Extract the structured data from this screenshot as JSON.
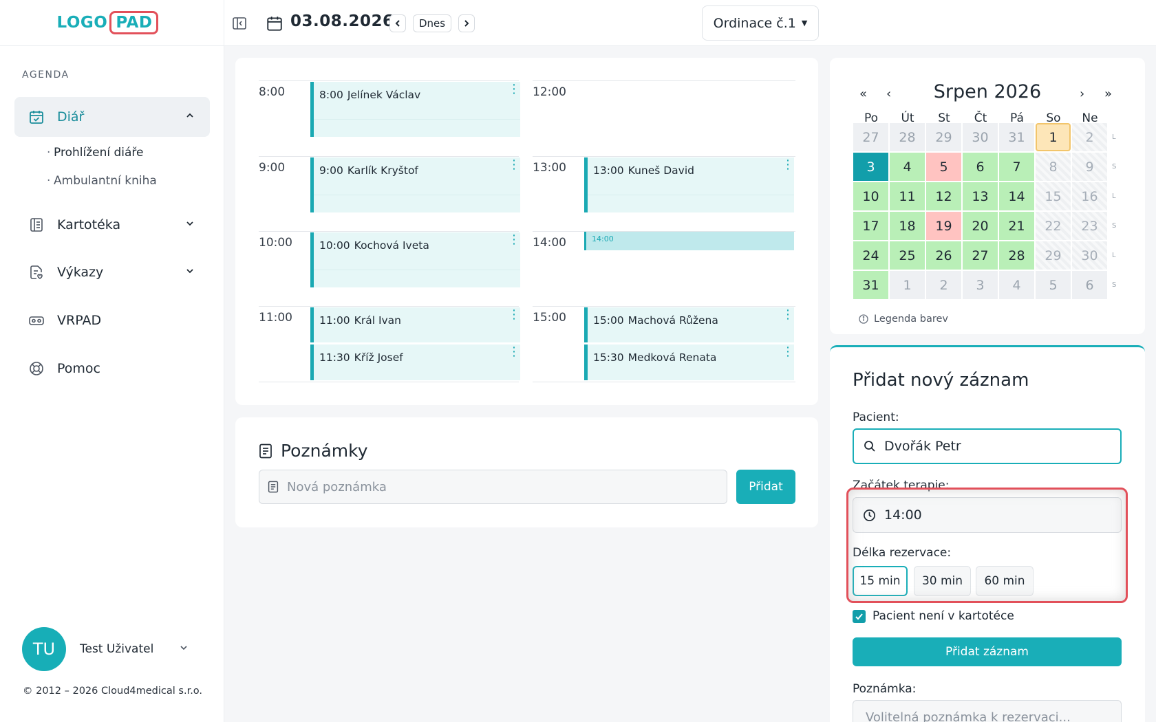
{
  "logo": {
    "part1": "LOGO",
    "part2": "PAD"
  },
  "sidebar": {
    "section_label": "AGENDA",
    "items": [
      {
        "label": "Diář",
        "icon": "calendar-check-icon"
      },
      {
        "label": "Kartotéka",
        "icon": "book-icon"
      },
      {
        "label": "Výkazy",
        "icon": "report-icon"
      },
      {
        "label": "VRPAD",
        "icon": "vr-headset-icon"
      },
      {
        "label": "Pomoc",
        "icon": "lifebuoy-icon"
      }
    ],
    "subitems": [
      "Prohlížení diáře",
      "Ambulantní kniha"
    ],
    "user": {
      "initials": "TU",
      "name": "Test Uživatel"
    },
    "copyright": "© 2012 – 2026 Cloud4medical s.r.o."
  },
  "topbar": {
    "date": "03.08.2026",
    "today_label": "Dnes",
    "office": "Ordinace č.1"
  },
  "schedule": {
    "hours": [
      "8:00",
      "9:00",
      "10:00",
      "11:00",
      "12:00",
      "13:00",
      "14:00",
      "15:00"
    ],
    "appointments": [
      {
        "time": "8:00",
        "name": "Jelínek Václav"
      },
      {
        "time": "9:00",
        "name": "Karlík Kryštof"
      },
      {
        "time": "10:00",
        "name": "Kochová Iveta"
      },
      {
        "time": "11:00",
        "name": "Král Ivan"
      },
      {
        "time": "11:30",
        "name": "Kříž Josef"
      },
      {
        "time": "13:00",
        "name": "Kuneš David"
      },
      {
        "time": "14:00",
        "name": ""
      },
      {
        "time": "15:00",
        "name": "Machová Růžena"
      },
      {
        "time": "15:30",
        "name": "Medková Renata"
      }
    ]
  },
  "notes": {
    "title": "Poznámky",
    "placeholder": "Nová poznámka",
    "add_label": "Přidat"
  },
  "calendar": {
    "prev_year": "«",
    "prev_month": "‹",
    "next_month": "›",
    "next_year": "»",
    "month": "Srpen 2026",
    "weekdays": [
      "Po",
      "Út",
      "St",
      "Čt",
      "Pá",
      "So",
      "Ne"
    ],
    "weeks": [
      [
        "27",
        "28",
        "29",
        "30",
        "31",
        "1",
        "2"
      ],
      [
        "3",
        "4",
        "5",
        "6",
        "7",
        "8",
        "9"
      ],
      [
        "10",
        "11",
        "12",
        "13",
        "14",
        "15",
        "16"
      ],
      [
        "17",
        "18",
        "19",
        "20",
        "21",
        "22",
        "23"
      ],
      [
        "24",
        "25",
        "26",
        "27",
        "28",
        "29",
        "30"
      ],
      [
        "31",
        "1",
        "2",
        "3",
        "4",
        "5",
        "6"
      ]
    ],
    "week_tags": [
      "L",
      "S",
      "L",
      "S",
      "L",
      "S"
    ],
    "legend": "Legenda barev",
    "colors": {
      "today": "#129eaa",
      "free": "#b9efb7",
      "full": "#ffc3c1",
      "selected": "#fde6b8"
    }
  },
  "form": {
    "title": "Přidat nový záznam",
    "patient_label": "Pacient:",
    "patient_value": "Dvořák Petr",
    "start_label": "Začátek terapie:",
    "start_value": "14:00",
    "duration_label": "Délka rezervace:",
    "durations": [
      "15 min",
      "30 min",
      "60 min"
    ],
    "checkbox_label": "Pacient není v kartotéce",
    "submit_label": "Přidat záznam",
    "note_label": "Poznámka:",
    "note_placeholder": "Volitelná poznámka k rezervaci..."
  },
  "accent_color": "#19aeb8"
}
